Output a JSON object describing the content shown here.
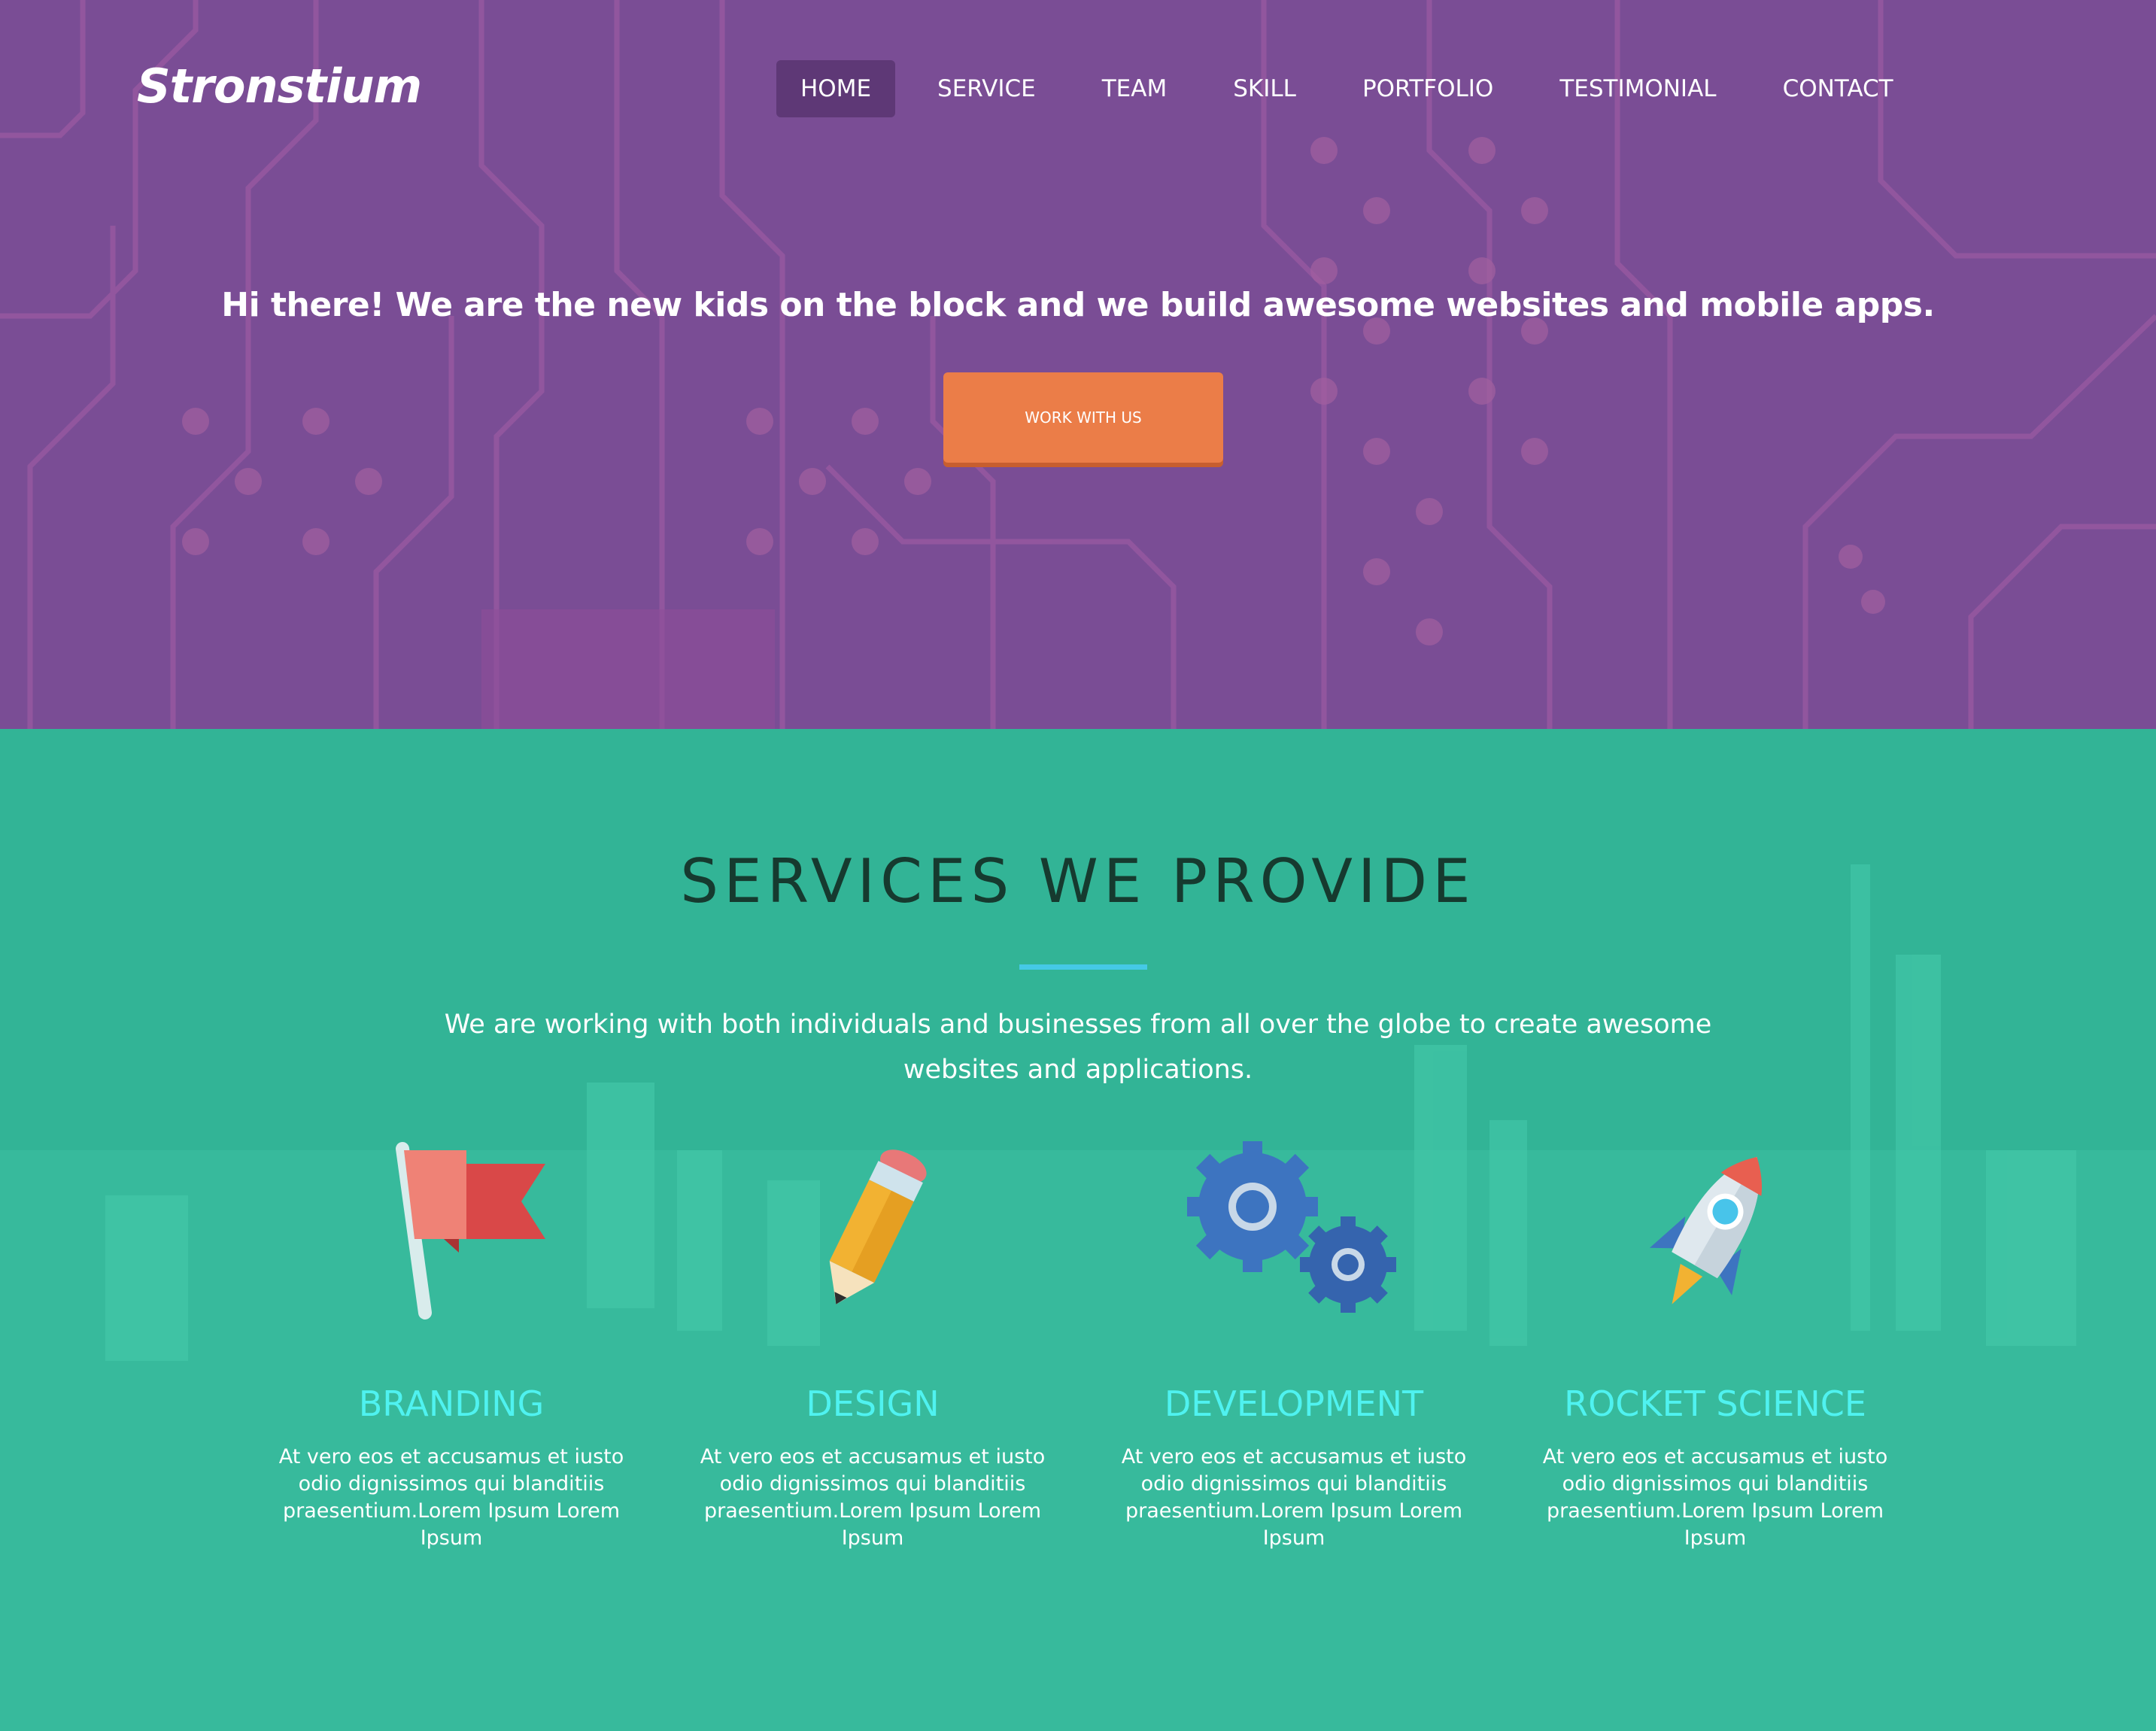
{
  "brand": {
    "name": "Stronstium"
  },
  "nav": {
    "items": [
      {
        "label": "HOME",
        "active": true
      },
      {
        "label": "SERVICE",
        "active": false
      },
      {
        "label": "TEAM",
        "active": false
      },
      {
        "label": "SKILL",
        "active": false
      },
      {
        "label": "PORTFOLIO",
        "active": false
      },
      {
        "label": "TESTIMONIAL",
        "active": false
      },
      {
        "label": "CONTACT",
        "active": false
      }
    ]
  },
  "hero": {
    "headline": "Hi there! We are the new kids on the block and we build awesome websites and mobile apps.",
    "cta_label": "WORK WITH US"
  },
  "services": {
    "title": "SERVICES WE PROVIDE",
    "intro": "We are working with both individuals and businesses from all over the globe to create awesome websites and applications.",
    "items": [
      {
        "icon": "flag-icon",
        "title": "BRANDING",
        "text": "At vero eos et accusamus et iusto odio dignissimos qui blanditiis praesentium.Lorem Ipsum Lorem Ipsum"
      },
      {
        "icon": "pencil-icon",
        "title": "DESIGN",
        "text": "At vero eos et accusamus et iusto odio dignissimos qui blanditiis praesentium.Lorem Ipsum Lorem Ipsum"
      },
      {
        "icon": "gears-icon",
        "title": "DEVELOPMENT",
        "text": "At vero eos et accusamus et iusto odio dignissimos qui blanditiis praesentium.Lorem Ipsum Lorem Ipsum"
      },
      {
        "icon": "rocket-icon",
        "title": "ROCKET SCIENCE",
        "text": "At vero eos et accusamus et iusto odio dignissimos qui blanditiis praesentium.Lorem Ipsum Lorem Ipsum"
      }
    ]
  },
  "colors": {
    "hero_bg": "#7a4d95",
    "services_bg": "#32b496",
    "cta": "#eb7d48",
    "accent_rule": "#45c9e6",
    "card_title": "#4ff2f0"
  }
}
